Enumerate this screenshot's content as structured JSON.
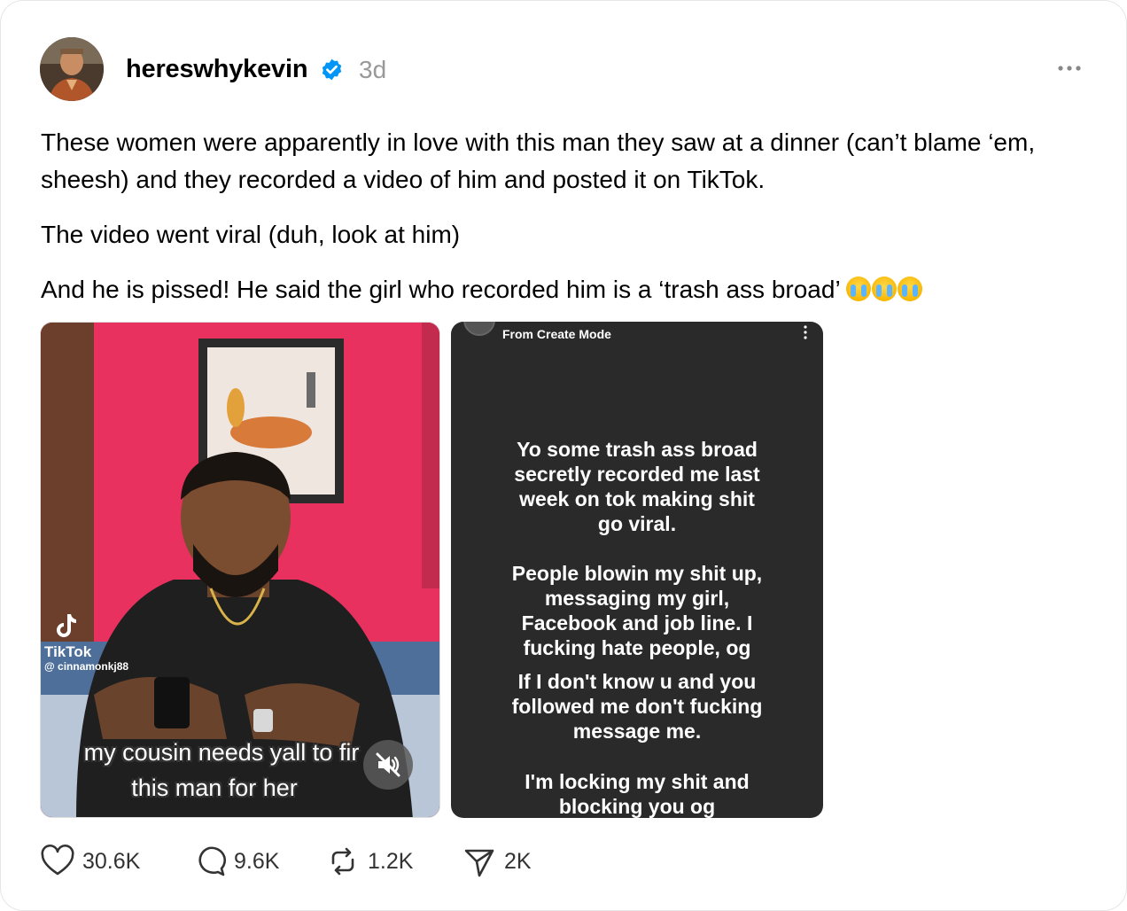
{
  "post": {
    "username": "hereswhykevin",
    "time": "3d",
    "paragraphs": [
      "These women were apparently in love with this man they saw at a dinner (can’t blame ‘em, sheesh) and they recorded a video of him and posted it on TikTok.",
      "The video went viral (duh, look at him)",
      "And he is pissed! He said the girl who recorded him is a ‘trash ass broad’"
    ],
    "emoji": "loudly-crying-face x3"
  },
  "media1": {
    "tiktok_label": "TikTok",
    "tiktok_handle": "@ cinnamonkj88",
    "caption_line1": "my cousin needs yall to fir",
    "caption_line2": "this man for her"
  },
  "media2": {
    "from_label": "From Create Mode",
    "block1": "Yo some trash ass broad secretly recorded me last week on tok making shit go viral.",
    "block2": "People blowin my shit up, messaging my girl, Facebook and job line. I fucking hate people, og",
    "block3": "If I don't know u and you followed me don't fucking message me.",
    "block4": "I'm locking my shit and blocking you og"
  },
  "actions": {
    "likes": "30.6K",
    "replies": "9.6K",
    "reposts": "1.2K",
    "shares": "2K"
  },
  "colors": {
    "verified_blue": "#0095f6",
    "media1_wall_pink": "#e7335d",
    "media2_bg": "#2a2a2a",
    "muted_text": "#999999"
  }
}
